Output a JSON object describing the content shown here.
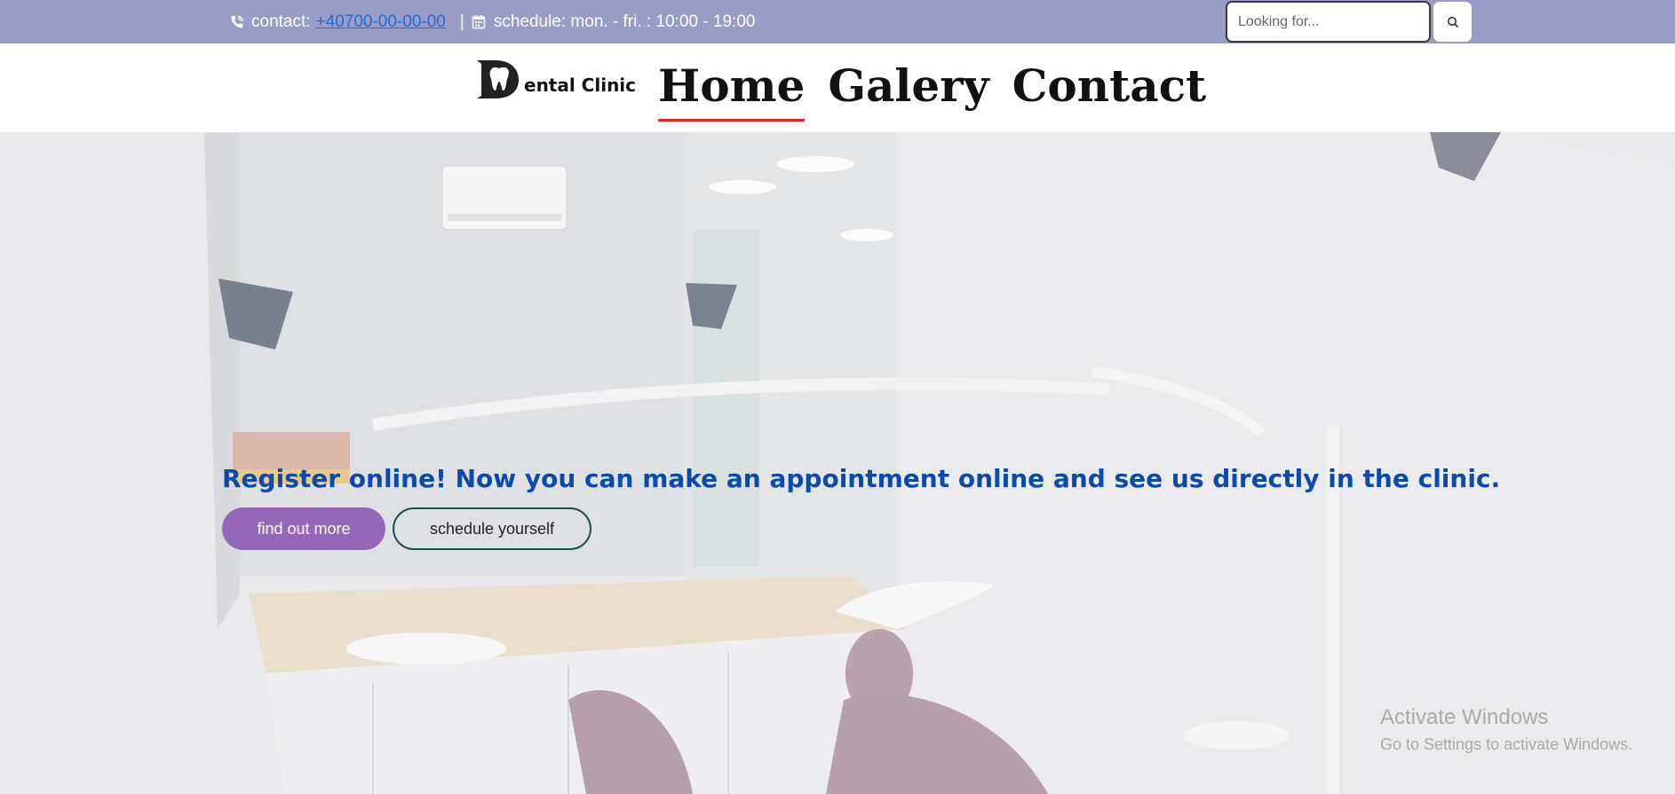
{
  "topbar": {
    "contact_label": "contact:",
    "phone": "+40700-00-00-00",
    "separator": "|",
    "schedule": "schedule: mon. - fri. : 10:00 - 19:00",
    "icons": {
      "phone": "phone-icon",
      "calendar": "calendar-icon"
    }
  },
  "search": {
    "placeholder": "Looking for...",
    "value": "",
    "button_icon": "search-icon"
  },
  "logo": {
    "letter": "D",
    "name": "ental Clinic"
  },
  "nav": [
    {
      "label": "Home",
      "active": true
    },
    {
      "label": "Galery",
      "active": false
    },
    {
      "label": "Contact",
      "active": false
    }
  ],
  "hero": {
    "headline": "Register online! Now you can make an appointment online and see us directly in the clinic.",
    "primary_button": "find out more",
    "secondary_button": "schedule yourself"
  },
  "watermark": {
    "title": "Activate Windows",
    "subtitle": "Go to Settings to activate Windows."
  },
  "colors": {
    "topbar": "#9b9bc8",
    "link": "#1b6fd6",
    "headline": "#0b4aa8",
    "primary_button": "#9467b8",
    "nav_underline": "#e02525"
  }
}
